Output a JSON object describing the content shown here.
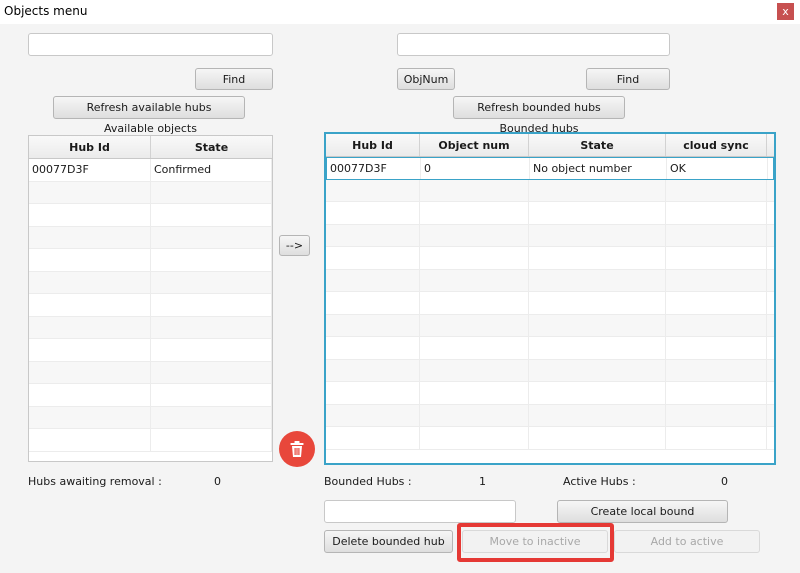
{
  "window": {
    "title": "Objects menu",
    "close_glyph": "x"
  },
  "left": {
    "search_value": "",
    "find_label": "Find",
    "refresh_label": "Refresh available hubs",
    "section_title": "Available objects",
    "columns": [
      "Hub Id",
      "State"
    ],
    "rows": [
      [
        "00077D3F",
        "Confirmed"
      ]
    ],
    "awaiting_label": "Hubs awaiting removal :",
    "awaiting_value": "0"
  },
  "transfer": {
    "label": "-->"
  },
  "trash": {
    "icon": "trash-icon",
    "color": "#e8473b"
  },
  "right": {
    "search_value": "",
    "objnum_label": "ObjNum",
    "find_label": "Find",
    "refresh_label": "Refresh bounded hubs",
    "section_title": "Bounded hubs",
    "columns": [
      "Hub Id",
      "Object num",
      "State",
      "cloud sync"
    ],
    "rows": [
      [
        "00077D3F",
        "0",
        "No object number",
        "OK"
      ]
    ],
    "bounded_label": "Bounded Hubs :",
    "bounded_value": "1",
    "active_label": "Active Hubs :",
    "active_value": "0",
    "local_bound_value": "",
    "create_local_label": "Create local bound",
    "delete_label": "Delete bounded hub",
    "move_inactive_label": "Move to inactive",
    "add_active_label": "Add to active"
  },
  "colors": {
    "accent": "#3aa3c8",
    "highlight": "#e53935",
    "close": "#c75050"
  }
}
